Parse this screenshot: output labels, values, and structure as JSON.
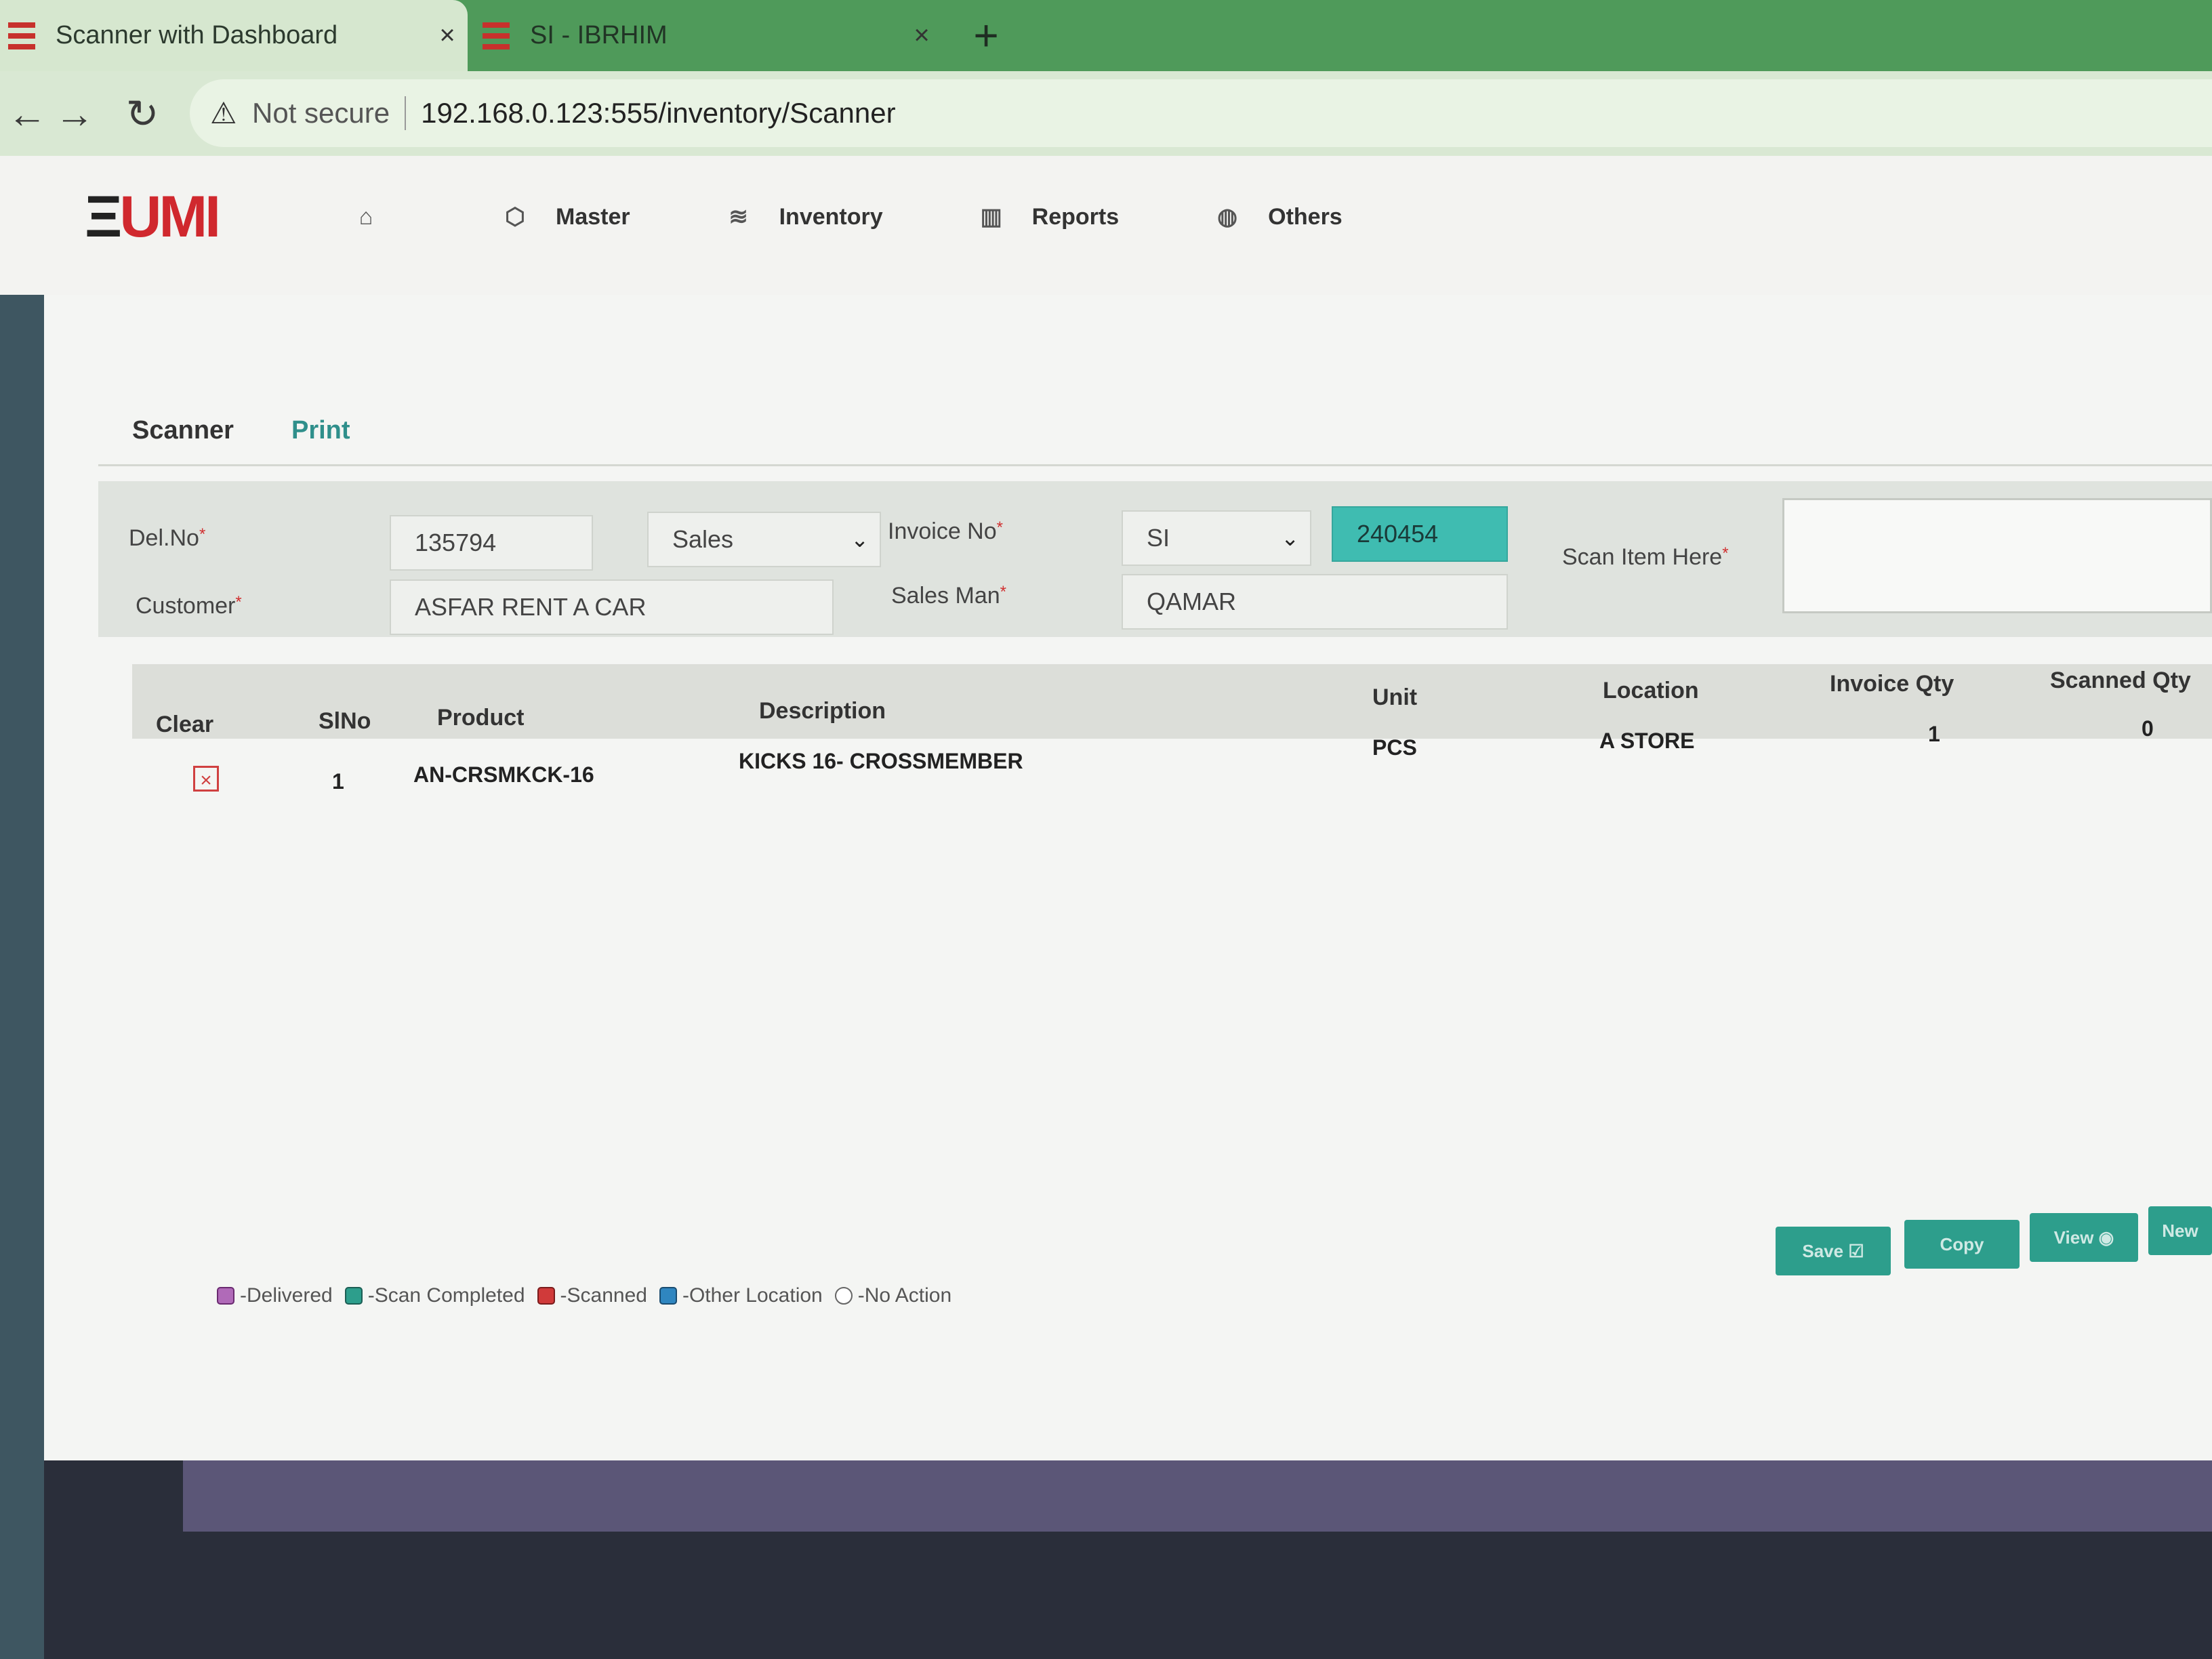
{
  "browser": {
    "tabs": [
      {
        "title": "Scanner with Dashboard",
        "close": "×"
      },
      {
        "title": "SI - IBRHIM",
        "close": "×"
      }
    ],
    "new_tab": "+",
    "not_secure": "Not secure",
    "url": "192.168.0.123:555/inventory/Scanner"
  },
  "app": {
    "logo": "EUMI",
    "nav": [
      {
        "label": "",
        "icon": "home-icon"
      },
      {
        "label": "Master",
        "icon": "box-icon"
      },
      {
        "label": "Inventory",
        "icon": "layers-icon"
      },
      {
        "label": "Reports",
        "icon": "bar-chart-icon"
      },
      {
        "label": "Others",
        "icon": "globe-icon"
      }
    ]
  },
  "page_tabs": {
    "scanner": "Scanner",
    "print": "Print"
  },
  "form": {
    "del_no_label": "Del.No",
    "del_no_value": "135794",
    "type_value": "Sales",
    "invoice_no_label": "Invoice No",
    "invoice_prefix_value": "SI",
    "invoice_no_value": "240454",
    "scan_item_label": "Scan Item Here",
    "customer_label": "Customer",
    "customer_value": "ASFAR RENT A CAR",
    "sales_man_label": "Sales Man",
    "sales_man_value": "QAMAR",
    "required_mark": "*"
  },
  "table": {
    "headers": [
      "Clear",
      "SlNo",
      "Product",
      "Description",
      "Unit",
      "Location",
      "Invoice Qty",
      "Scanned Qty"
    ],
    "rows": [
      {
        "slno": "1",
        "product": "AN-CRSMKCK-16",
        "description": "KICKS 16- CROSSMEMBER",
        "unit": "PCS",
        "location": "A STORE",
        "invoice_qty": "1",
        "scanned_qty": "0"
      }
    ]
  },
  "buttons": {
    "save": "Save",
    "copy": "Copy",
    "view": "View",
    "new": "New"
  },
  "legend": [
    {
      "label": "-Delivered",
      "color": "#b06ab8"
    },
    {
      "label": "-Scan Completed",
      "color": "#2d9e8c"
    },
    {
      "label": "-Scanned",
      "color": "#d03a3a"
    },
    {
      "label": "-Other Location",
      "color": "#2f86c0"
    },
    {
      "label": "-No Action",
      "color": "#ffffff"
    }
  ]
}
